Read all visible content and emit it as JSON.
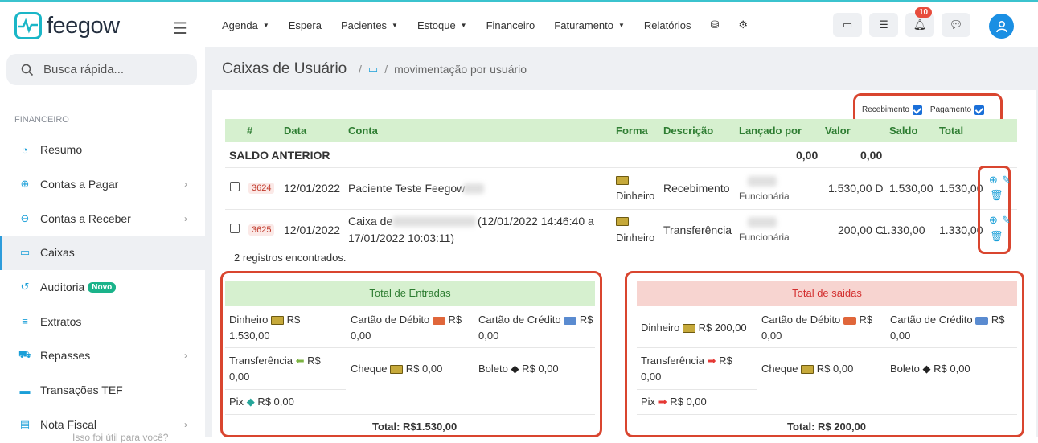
{
  "brand": {
    "name": "feegow"
  },
  "search": {
    "placeholder": "Busca rápida..."
  },
  "sidebar": {
    "section": "FINANCEIRO",
    "items": [
      {
        "label": "Resumo",
        "icon": "chart-pie-icon",
        "chevron": false
      },
      {
        "label": "Contas a Pagar",
        "icon": "arrow-up-circle-icon",
        "chevron": true
      },
      {
        "label": "Contas a Receber",
        "icon": "arrow-down-circle-icon",
        "chevron": true
      },
      {
        "label": "Caixas",
        "icon": "inbox-icon",
        "chevron": false,
        "active": true
      },
      {
        "label": "Auditoria",
        "icon": "history-icon",
        "chevron": false,
        "badge": "Novo"
      },
      {
        "label": "Extratos",
        "icon": "list-icon",
        "chevron": false
      },
      {
        "label": "Repasses",
        "icon": "truck-icon",
        "chevron": true
      },
      {
        "label": "Transações TEF",
        "icon": "credit-card-icon",
        "chevron": false
      },
      {
        "label": "Nota Fiscal",
        "icon": "file-icon",
        "chevron": true
      }
    ]
  },
  "topnav": {
    "menu": [
      {
        "label": "Agenda",
        "dropdown": true
      },
      {
        "label": "Espera",
        "dropdown": false
      },
      {
        "label": "Pacientes",
        "dropdown": true
      },
      {
        "label": "Estoque",
        "dropdown": true
      },
      {
        "label": "Financeiro",
        "dropdown": false
      },
      {
        "label": "Faturamento",
        "dropdown": true
      },
      {
        "label": "Relatórios",
        "dropdown": false
      }
    ],
    "notification_count": "10"
  },
  "page": {
    "title": "Caixas de Usuário",
    "breadcrumb_sep": "/",
    "breadcrumb": "movimentação por usuário"
  },
  "filters": {
    "receipt": "Recebimento",
    "payment": "Pagamento"
  },
  "table": {
    "headers": [
      "#",
      "Data",
      "Conta",
      "Forma",
      "Descrição",
      "Lançado por",
      "Valor",
      "Saldo",
      "Total"
    ],
    "previous_balance": {
      "label": "SALDO ANTERIOR",
      "valor": "0,00",
      "saldo": "0,00"
    },
    "rows": [
      {
        "id": "3624",
        "date": "12/01/2022",
        "account": "Paciente Teste Feegow",
        "method": "Dinheiro",
        "description": "Recebimento",
        "author_role": "Funcionária",
        "valor": "1.530,00 D",
        "saldo": "1.530,00",
        "total": "1.530,00"
      },
      {
        "id": "3625",
        "date": "12/01/2022",
        "account_prefix": "Caixa de",
        "account_suffix": "(12/01/2022 14:46:40 a",
        "account_line2": "17/01/2022 10:03:11)",
        "method": "Dinheiro",
        "description": "Transferência",
        "author_role": "Funcionária",
        "valor": "200,00 C",
        "saldo": "1.330,00",
        "total": "1.330,00"
      }
    ],
    "count_text": "2 registros encontrados."
  },
  "entradas": {
    "title": "Total de Entradas",
    "dinheiro_label": "Dinheiro",
    "dinheiro_val": "R$",
    "dinheiro_val2": "1.530,00",
    "debito_label": "Cartão de Débito",
    "debito_val": "R$",
    "debito_val2": "0,00",
    "credito_label": "Cartão de Crédito",
    "credito_val": "R$",
    "credito_val2": "0,00",
    "transf_label": "Transferência",
    "transf_val": "R$",
    "transf_val2": "0,00",
    "cheque_label": "Cheque",
    "cheque_val": "R$ 0,00",
    "boleto_label": "Boleto",
    "boleto_val": "R$ 0,00",
    "pix_label": "Pix",
    "pix_val": "R$ 0,00",
    "total": "Total: R$1.530,00"
  },
  "saidas": {
    "title": "Total de saidas",
    "dinheiro_label": "Dinheiro",
    "dinheiro_val": "R$ 200,00",
    "debito_label": "Cartão de Débito",
    "debito_val": "R$",
    "debito_val2": "0,00",
    "credito_label": "Cartão de Crédito",
    "credito_val": "R$",
    "credito_val2": "0,00",
    "transf_label": "Transferência",
    "transf_val": "R$",
    "transf_val2": "0,00",
    "cheque_label": "Cheque",
    "cheque_val": "R$ 0,00",
    "boleto_label": "Boleto",
    "boleto_val": "R$ 0,00",
    "pix_label": "Pix",
    "pix_val": "R$ 0,00",
    "total": "Total: R$ 200,00"
  },
  "footer": {
    "faded_text": "Isso foi útil para você?"
  },
  "colors": {
    "accent": "#1ab6c7",
    "highlight": "#d9452f",
    "entradas_bg": "#d6f0cf",
    "saidas_bg": "#f7d4d0"
  }
}
